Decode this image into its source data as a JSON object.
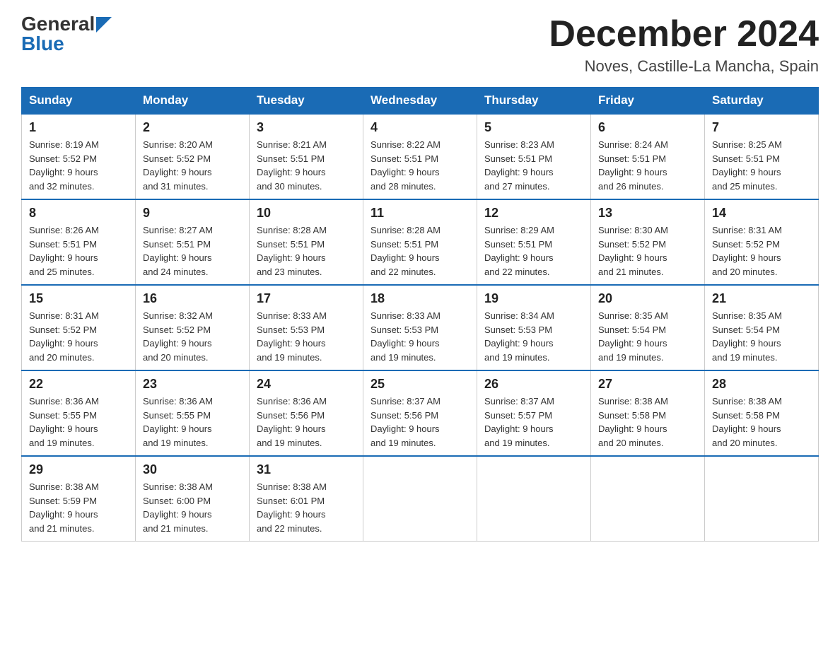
{
  "header": {
    "logo_general": "General",
    "logo_blue": "Blue",
    "month_title": "December 2024",
    "location": "Noves, Castille-La Mancha, Spain"
  },
  "weekdays": [
    "Sunday",
    "Monday",
    "Tuesday",
    "Wednesday",
    "Thursday",
    "Friday",
    "Saturday"
  ],
  "weeks": [
    [
      {
        "day": "1",
        "sunrise": "8:19 AM",
        "sunset": "5:52 PM",
        "daylight": "9 hours and 32 minutes."
      },
      {
        "day": "2",
        "sunrise": "8:20 AM",
        "sunset": "5:52 PM",
        "daylight": "9 hours and 31 minutes."
      },
      {
        "day": "3",
        "sunrise": "8:21 AM",
        "sunset": "5:51 PM",
        "daylight": "9 hours and 30 minutes."
      },
      {
        "day": "4",
        "sunrise": "8:22 AM",
        "sunset": "5:51 PM",
        "daylight": "9 hours and 28 minutes."
      },
      {
        "day": "5",
        "sunrise": "8:23 AM",
        "sunset": "5:51 PM",
        "daylight": "9 hours and 27 minutes."
      },
      {
        "day": "6",
        "sunrise": "8:24 AM",
        "sunset": "5:51 PM",
        "daylight": "9 hours and 26 minutes."
      },
      {
        "day": "7",
        "sunrise": "8:25 AM",
        "sunset": "5:51 PM",
        "daylight": "9 hours and 25 minutes."
      }
    ],
    [
      {
        "day": "8",
        "sunrise": "8:26 AM",
        "sunset": "5:51 PM",
        "daylight": "9 hours and 25 minutes."
      },
      {
        "day": "9",
        "sunrise": "8:27 AM",
        "sunset": "5:51 PM",
        "daylight": "9 hours and 24 minutes."
      },
      {
        "day": "10",
        "sunrise": "8:28 AM",
        "sunset": "5:51 PM",
        "daylight": "9 hours and 23 minutes."
      },
      {
        "day": "11",
        "sunrise": "8:28 AM",
        "sunset": "5:51 PM",
        "daylight": "9 hours and 22 minutes."
      },
      {
        "day": "12",
        "sunrise": "8:29 AM",
        "sunset": "5:51 PM",
        "daylight": "9 hours and 22 minutes."
      },
      {
        "day": "13",
        "sunrise": "8:30 AM",
        "sunset": "5:52 PM",
        "daylight": "9 hours and 21 minutes."
      },
      {
        "day": "14",
        "sunrise": "8:31 AM",
        "sunset": "5:52 PM",
        "daylight": "9 hours and 20 minutes."
      }
    ],
    [
      {
        "day": "15",
        "sunrise": "8:31 AM",
        "sunset": "5:52 PM",
        "daylight": "9 hours and 20 minutes."
      },
      {
        "day": "16",
        "sunrise": "8:32 AM",
        "sunset": "5:52 PM",
        "daylight": "9 hours and 20 minutes."
      },
      {
        "day": "17",
        "sunrise": "8:33 AM",
        "sunset": "5:53 PM",
        "daylight": "9 hours and 19 minutes."
      },
      {
        "day": "18",
        "sunrise": "8:33 AM",
        "sunset": "5:53 PM",
        "daylight": "9 hours and 19 minutes."
      },
      {
        "day": "19",
        "sunrise": "8:34 AM",
        "sunset": "5:53 PM",
        "daylight": "9 hours and 19 minutes."
      },
      {
        "day": "20",
        "sunrise": "8:35 AM",
        "sunset": "5:54 PM",
        "daylight": "9 hours and 19 minutes."
      },
      {
        "day": "21",
        "sunrise": "8:35 AM",
        "sunset": "5:54 PM",
        "daylight": "9 hours and 19 minutes."
      }
    ],
    [
      {
        "day": "22",
        "sunrise": "8:36 AM",
        "sunset": "5:55 PM",
        "daylight": "9 hours and 19 minutes."
      },
      {
        "day": "23",
        "sunrise": "8:36 AM",
        "sunset": "5:55 PM",
        "daylight": "9 hours and 19 minutes."
      },
      {
        "day": "24",
        "sunrise": "8:36 AM",
        "sunset": "5:56 PM",
        "daylight": "9 hours and 19 minutes."
      },
      {
        "day": "25",
        "sunrise": "8:37 AM",
        "sunset": "5:56 PM",
        "daylight": "9 hours and 19 minutes."
      },
      {
        "day": "26",
        "sunrise": "8:37 AM",
        "sunset": "5:57 PM",
        "daylight": "9 hours and 19 minutes."
      },
      {
        "day": "27",
        "sunrise": "8:38 AM",
        "sunset": "5:58 PM",
        "daylight": "9 hours and 20 minutes."
      },
      {
        "day": "28",
        "sunrise": "8:38 AM",
        "sunset": "5:58 PM",
        "daylight": "9 hours and 20 minutes."
      }
    ],
    [
      {
        "day": "29",
        "sunrise": "8:38 AM",
        "sunset": "5:59 PM",
        "daylight": "9 hours and 21 minutes."
      },
      {
        "day": "30",
        "sunrise": "8:38 AM",
        "sunset": "6:00 PM",
        "daylight": "9 hours and 21 minutes."
      },
      {
        "day": "31",
        "sunrise": "8:38 AM",
        "sunset": "6:01 PM",
        "daylight": "9 hours and 22 minutes."
      },
      null,
      null,
      null,
      null
    ]
  ],
  "labels": {
    "sunrise": "Sunrise:",
    "sunset": "Sunset:",
    "daylight": "Daylight:"
  }
}
